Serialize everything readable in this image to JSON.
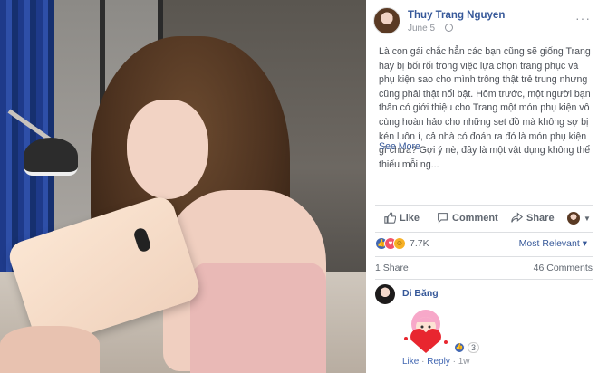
{
  "post": {
    "author": "Thuy Trang Nguyen",
    "date": "June 5",
    "meta_separator": "·",
    "body": "Là con gái chắc hẳn các bạn cũng sẽ giống Trang hay bị bối rối trong việc lựa chọn trang phục và phụ kiện sao cho mình trông thật trẻ trung nhưng cũng phải thật nổi bật. Hôm trước, một người bạn thân có giới thiệu cho Trang một món phụ kiện vô cùng hoàn hảo cho những set đồ mà không sợ bị kén luôn í, cả nhà có đoán ra đó là món phụ kiện gì chưa? Gợi ý nè, đây là một vật dụng không thể thiếu mỗi ng...",
    "see_more": "See More",
    "more_options": "···"
  },
  "actions": {
    "like": "Like",
    "comment": "Comment",
    "share": "Share"
  },
  "reactions": {
    "count": "7.7K",
    "sort_label": "Most Relevant",
    "sort_caret": "▾",
    "icons": [
      "like-reaction",
      "love-reaction",
      "haha-reaction"
    ]
  },
  "stats": {
    "shares": "1 Share",
    "comments": "46 Comments"
  },
  "comment": {
    "author": "Di Băng",
    "reaction_count": "3",
    "like": "Like",
    "reply": "Reply",
    "time": "1w",
    "separator": "·"
  },
  "colors": {
    "link": "#365899",
    "secondary_text": "#90949c",
    "like_blue": "#4267b2",
    "love_red": "#f25268",
    "haha_yellow": "#f7b125"
  }
}
